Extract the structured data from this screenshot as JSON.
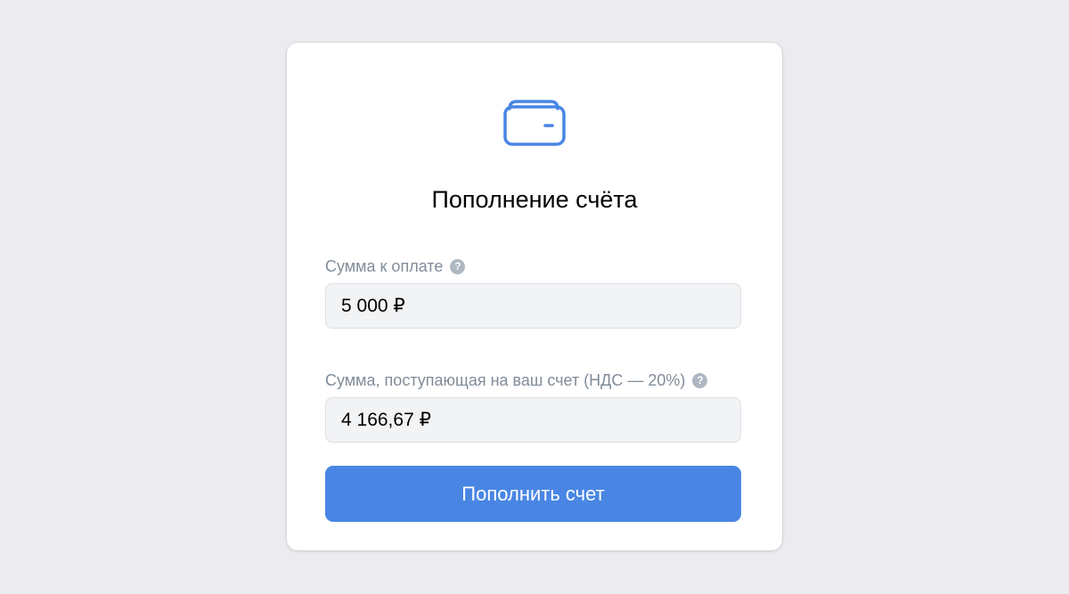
{
  "icon": "wallet-icon",
  "colors": {
    "background": "#ebebf0",
    "accent": "#4986e4",
    "label": "#818c99",
    "field_bg": "#f2f3f5"
  },
  "dialog": {
    "title": "Пополнение счёта",
    "amount_to_pay": {
      "label": "Сумма к оплате",
      "help_icon": "help-icon",
      "value": "5 000 ₽"
    },
    "amount_received": {
      "label": "Сумма, поступающая на ваш счет (НДС — 20%)",
      "help_icon": "help-icon",
      "value": "4 166,67 ₽"
    },
    "submit_label": "Пополнить счет"
  }
}
